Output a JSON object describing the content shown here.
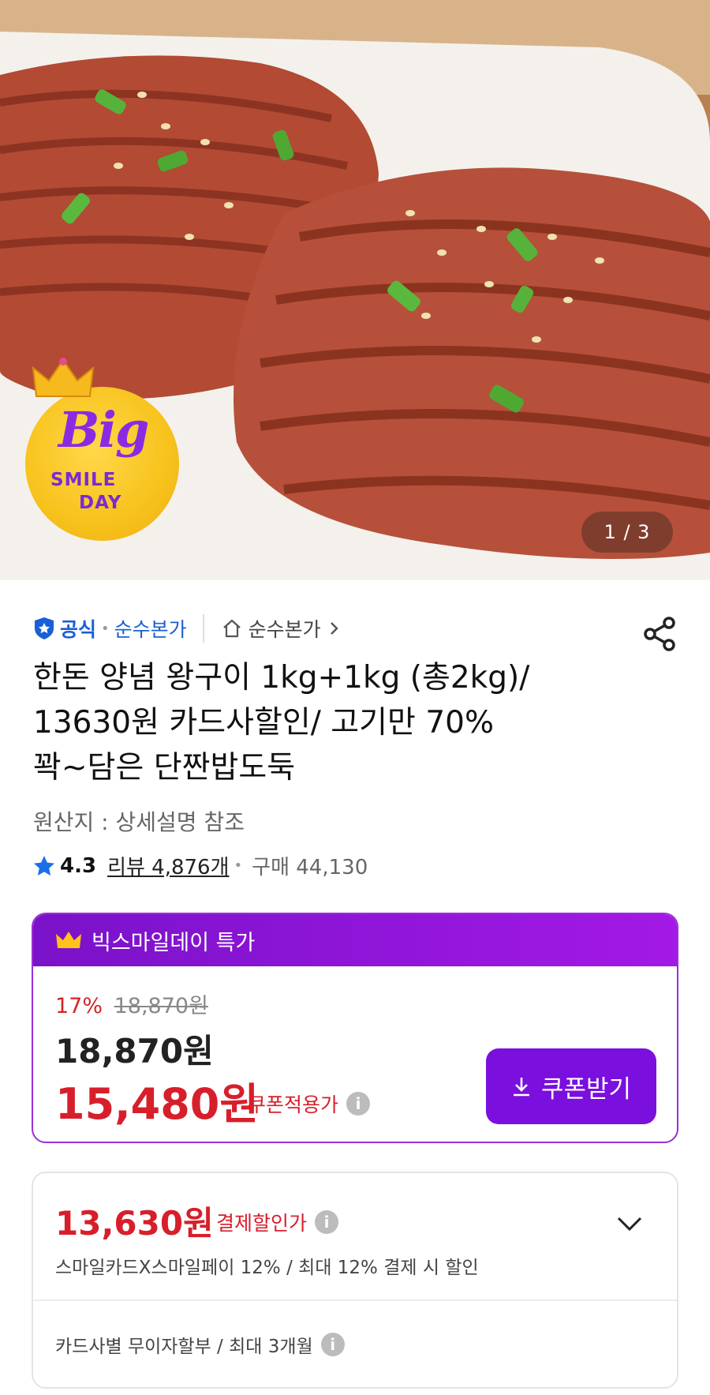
{
  "hero": {
    "counter": "1 / 3",
    "badge": {
      "line1": "Big",
      "line2": "SMILE",
      "line3": "DAY"
    }
  },
  "seller": {
    "official_label": "공식",
    "name": "순수본가",
    "store_link": "순수본가"
  },
  "product": {
    "title_line1": "한돈 양념 왕구이  1kg+1kg (총2kg)/",
    "title_line2": "13630원 카드사할인/ 고기만 70%",
    "title_line3": "꽉~담은 단짠밥도둑",
    "origin": "원산지 : 상세설명 참조",
    "rating": "4.3",
    "reviews": "리뷰 4,876개",
    "purchases": "구매 44,130"
  },
  "promo": {
    "header": "빅스마일데이 특가",
    "discount_pct": "17%",
    "original_price": "18,870원",
    "sale_price": "18,870원",
    "coupon_price": "15,480원",
    "coupon_label": "쿠폰적용가",
    "coupon_button": "쿠폰받기"
  },
  "payment": {
    "price": "13,630원",
    "label": "결제할인가",
    "description": "스마일카드X스마일페이 12% / 최대 12% 결제 시 할인",
    "installment": "카드사별 무이자할부 / 최대 3개월"
  },
  "colors": {
    "accent_purple": "#7a0fde",
    "price_red": "#d71f2b",
    "official_blue": "#1a5fd6"
  }
}
